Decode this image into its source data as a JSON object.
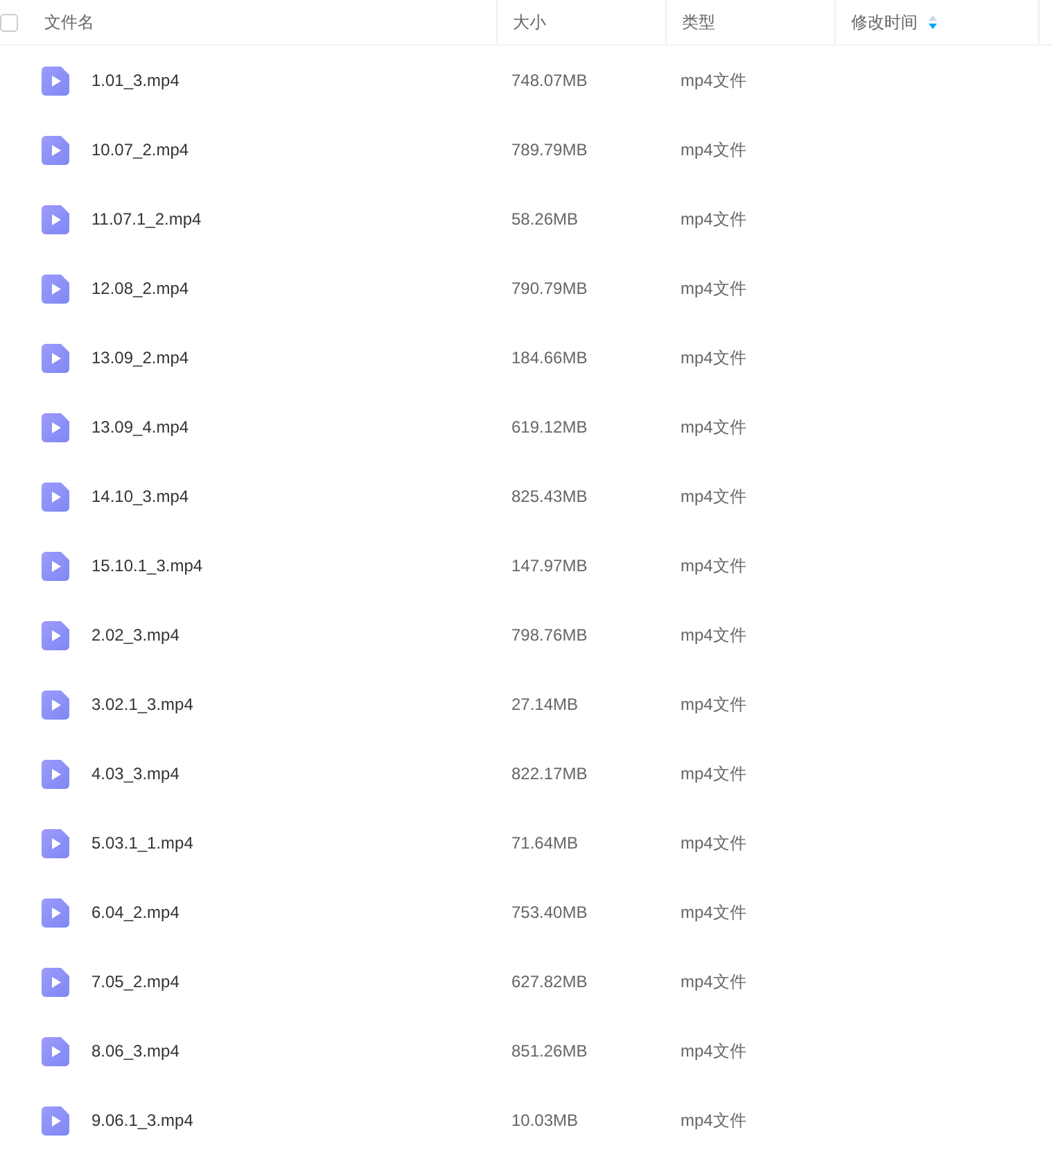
{
  "header": {
    "select_all": {
      "checked": false
    },
    "columns": [
      {
        "label": "文件名"
      },
      {
        "label": "大小"
      },
      {
        "label": "类型"
      },
      {
        "label": "修改时间",
        "sorted": true,
        "descending": true
      }
    ]
  },
  "files": [
    {
      "name": "1.01_3.mp4",
      "size": "748.07MB",
      "type": "mp4文件"
    },
    {
      "name": "10.07_2.mp4",
      "size": "789.79MB",
      "type": "mp4文件"
    },
    {
      "name": "11.07.1_2.mp4",
      "size": "58.26MB",
      "type": "mp4文件"
    },
    {
      "name": "12.08_2.mp4",
      "size": "790.79MB",
      "type": "mp4文件"
    },
    {
      "name": "13.09_2.mp4",
      "size": "184.66MB",
      "type": "mp4文件"
    },
    {
      "name": "13.09_4.mp4",
      "size": "619.12MB",
      "type": "mp4文件"
    },
    {
      "name": "14.10_3.mp4",
      "size": "825.43MB",
      "type": "mp4文件"
    },
    {
      "name": "15.10.1_3.mp4",
      "size": "147.97MB",
      "type": "mp4文件"
    },
    {
      "name": "2.02_3.mp4",
      "size": "798.76MB",
      "type": "mp4文件"
    },
    {
      "name": "3.02.1_3.mp4",
      "size": "27.14MB",
      "type": "mp4文件"
    },
    {
      "name": "4.03_3.mp4",
      "size": "822.17MB",
      "type": "mp4文件"
    },
    {
      "name": "5.03.1_1.mp4",
      "size": "71.64MB",
      "type": "mp4文件"
    },
    {
      "name": "6.04_2.mp4",
      "size": "753.40MB",
      "type": "mp4文件"
    },
    {
      "name": "7.05_2.mp4",
      "size": "627.82MB",
      "type": "mp4文件"
    },
    {
      "name": "8.06_3.mp4",
      "size": "851.26MB",
      "type": "mp4文件"
    },
    {
      "name": "9.06.1_3.mp4",
      "size": "10.03MB",
      "type": "mp4文件"
    }
  ]
}
